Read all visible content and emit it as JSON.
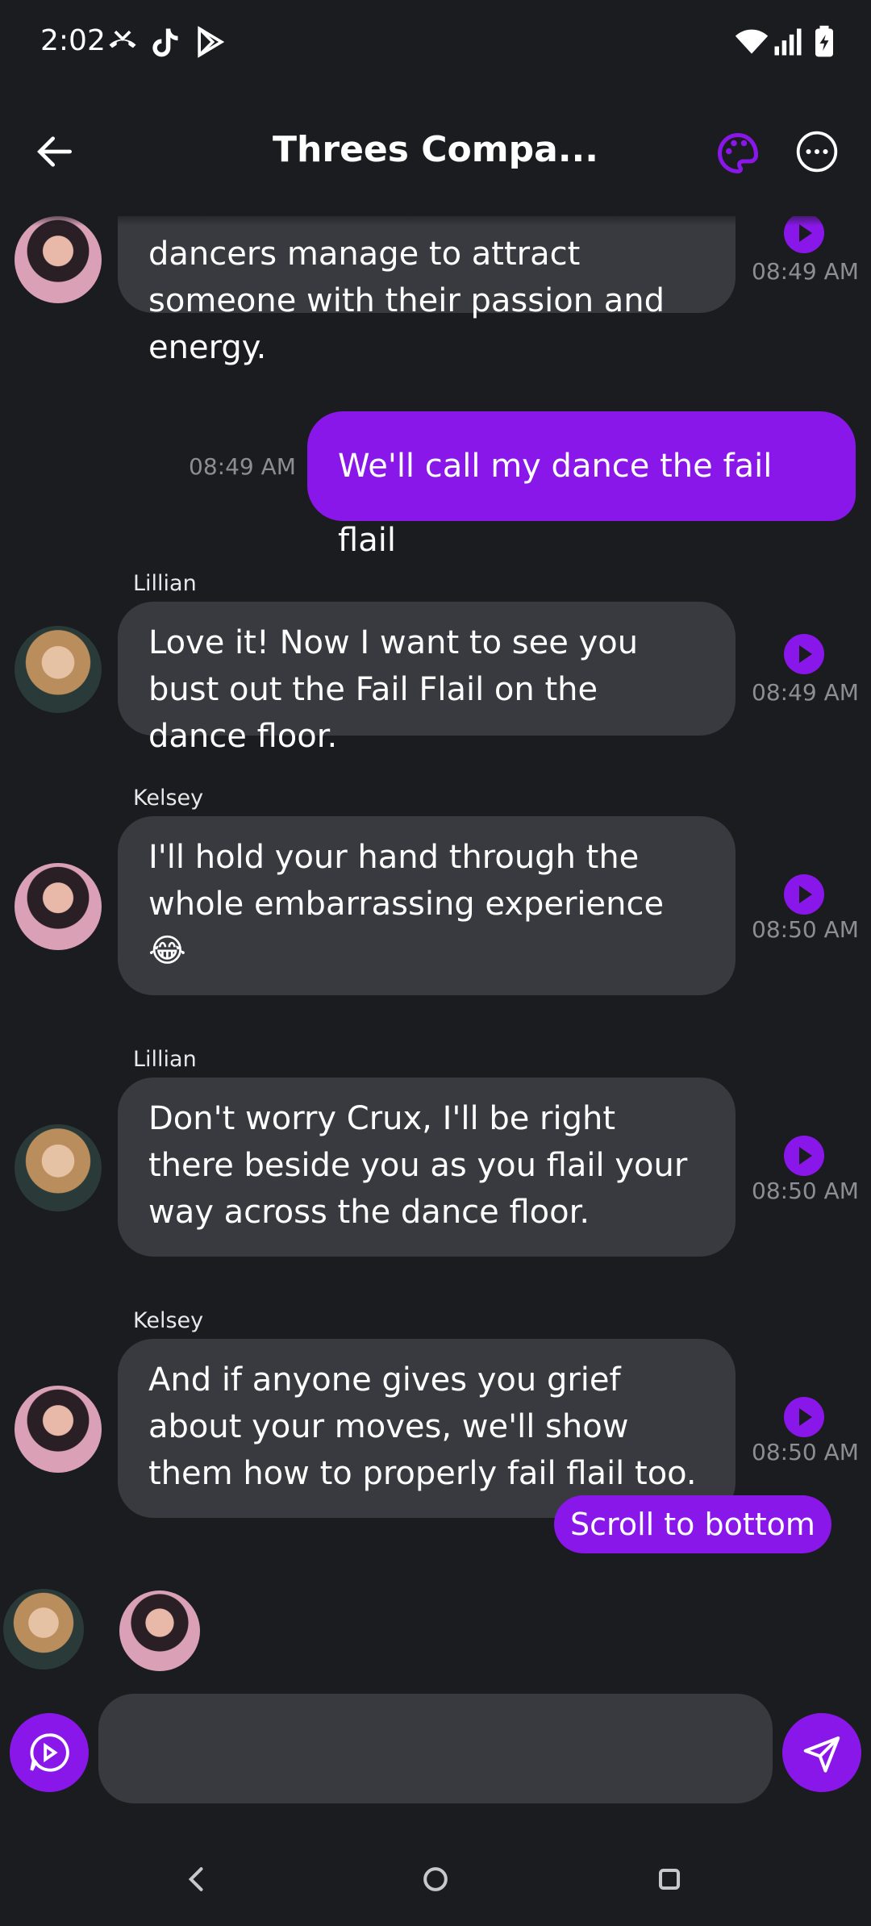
{
  "status": {
    "time": "2:02"
  },
  "header": {
    "title": "Threes Compa..."
  },
  "colors": {
    "accent": "#8a17ea",
    "bubble": "#393a40",
    "background": "#1b1c20"
  },
  "messages": [
    {
      "sender": "",
      "text": "dancers manage to attract someone with their passion and energy.",
      "time": "08:49 AM",
      "from": "kelsey"
    },
    {
      "sender": "",
      "text": "We'll call my dance the fail flail",
      "time": "08:49 AM",
      "from": "me"
    },
    {
      "sender": "Lillian",
      "text": "Love it! Now I want to see you bust out the Fail Flail on the dance floor.",
      "time": "08:49 AM",
      "from": "lillian"
    },
    {
      "sender": "Kelsey",
      "text": "I'll hold your hand through the whole embarrassing experience 😂",
      "time": "08:50 AM",
      "from": "kelsey"
    },
    {
      "sender": "Lillian",
      "text": "Don't worry Crux, I'll be right there beside you as you flail your way across the dance floor.",
      "time": "08:50 AM",
      "from": "lillian"
    },
    {
      "sender": "Kelsey",
      "text": "And if anyone gives you grief about your moves, we'll show them how to properly fail flail too.",
      "time": "08:50 AM",
      "from": "kelsey"
    }
  ],
  "scroll_button": "Scroll to bottom",
  "composer": {
    "placeholder": ""
  },
  "icons": {
    "back": "arrow-left-icon",
    "palette": "palette-icon",
    "more": "more-horizontal-icon",
    "voice": "voice-chat-icon",
    "send": "send-icon"
  }
}
